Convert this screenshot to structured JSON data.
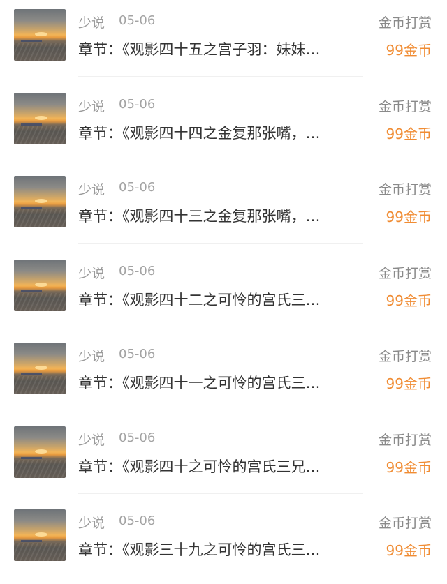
{
  "items": [
    {
      "author": "少说",
      "date": "05-06",
      "chapter": "章节：《观影四十五之宫子羽：妹妹…",
      "action": "金币打赏",
      "amount": "99金币"
    },
    {
      "author": "少说",
      "date": "05-06",
      "chapter": "章节：《观影四十四之金复那张嘴，…",
      "action": "金币打赏",
      "amount": "99金币"
    },
    {
      "author": "少说",
      "date": "05-06",
      "chapter": "章节：《观影四十三之金复那张嘴，…",
      "action": "金币打赏",
      "amount": "99金币"
    },
    {
      "author": "少说",
      "date": "05-06",
      "chapter": "章节：《观影四十二之可怜的宫氏三…",
      "action": "金币打赏",
      "amount": "99金币"
    },
    {
      "author": "少说",
      "date": "05-06",
      "chapter": "章节：《观影四十一之可怜的宫氏三…",
      "action": "金币打赏",
      "amount": "99金币"
    },
    {
      "author": "少说",
      "date": "05-06",
      "chapter": "章节：《观影四十之可怜的宫氏三兄…",
      "action": "金币打赏",
      "amount": "99金币"
    },
    {
      "author": "少说",
      "date": "05-06",
      "chapter": "章节：《观影三十九之可怜的宫氏三…",
      "action": "金币打赏",
      "amount": "99金币"
    }
  ],
  "colors": {
    "amount": "#f08c33",
    "muted": "#9a9a9a",
    "text": "#333333",
    "divider": "#f0f0f0"
  }
}
